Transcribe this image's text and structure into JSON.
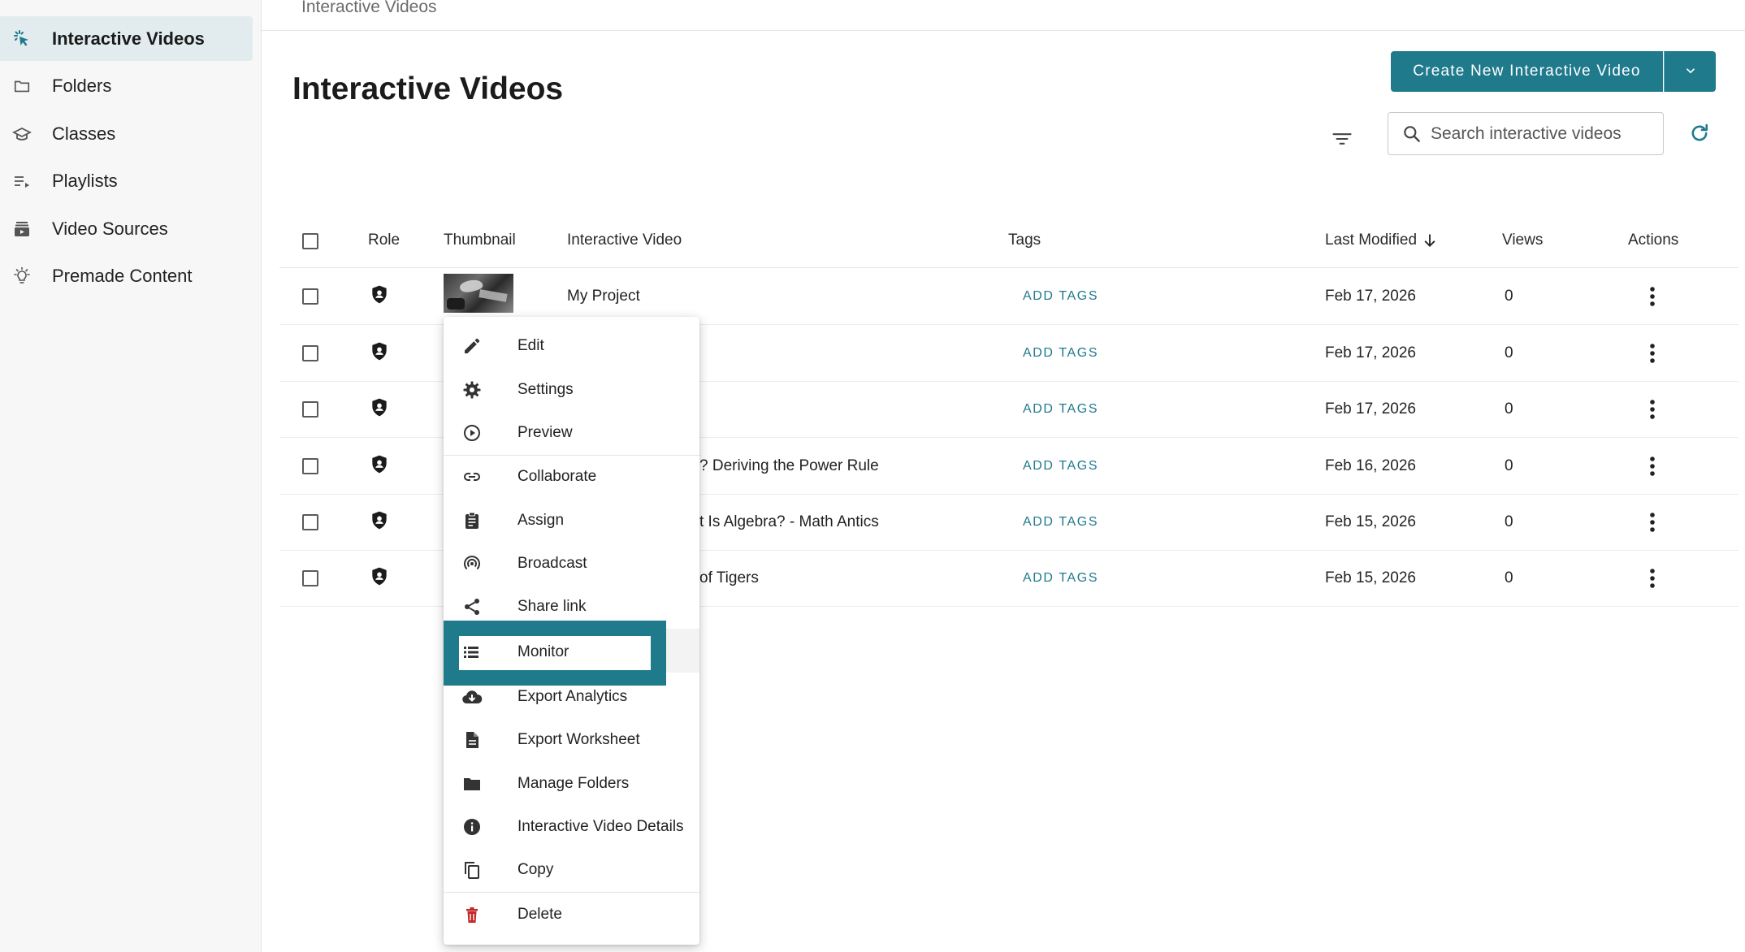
{
  "colors": {
    "accent": "#1f7a8c",
    "delete": "#c62828",
    "highlight": "#1f7a8c"
  },
  "sidebar": {
    "items": [
      {
        "label": "Interactive Videos",
        "icon": "cursor-click-icon",
        "active": true
      },
      {
        "label": "Folders",
        "icon": "folder-icon"
      },
      {
        "label": "Classes",
        "icon": "graduation-cap-icon"
      },
      {
        "label": "Playlists",
        "icon": "playlist-icon"
      },
      {
        "label": "Video Sources",
        "icon": "video-library-icon"
      },
      {
        "label": "Premade Content",
        "icon": "lightbulb-icon"
      }
    ]
  },
  "header": {
    "breadcrumb": "Interactive Videos",
    "title": "Interactive Videos",
    "create_label": "Create New Interactive Video",
    "search_placeholder": "Search interactive videos"
  },
  "table": {
    "columns": {
      "role": "Role",
      "thumbnail": "Thumbnail",
      "video": "Interactive Video",
      "tags": "Tags",
      "modified": "Last Modified",
      "views": "Views",
      "actions": "Actions"
    },
    "rows": [
      {
        "title": "My Project",
        "tags": "ADD TAGS",
        "modified": "Feb 17, 2026",
        "views": "0"
      },
      {
        "title": "",
        "tags": "ADD TAGS",
        "modified": "Feb 17, 2026",
        "views": "0"
      },
      {
        "title": "",
        "tags": "ADD TAGS",
        "modified": "Feb 17, 2026",
        "views": "0"
      },
      {
        "title": "? Deriving the Power Rule",
        "tags": "ADD TAGS",
        "modified": "Feb 16, 2026",
        "views": "0"
      },
      {
        "title": "t Is Algebra? - Math Antics",
        "tags": "ADD TAGS",
        "modified": "Feb 15, 2026",
        "views": "0"
      },
      {
        "title": "of Tigers",
        "tags": "ADD TAGS",
        "modified": "Feb 15, 2026",
        "views": "0"
      }
    ]
  },
  "menu": {
    "items": [
      {
        "label": "Edit",
        "icon": "pencil-icon"
      },
      {
        "label": "Settings",
        "icon": "gear-icon"
      },
      {
        "label": "Preview",
        "icon": "play-circle-icon"
      },
      {
        "label": "Collaborate",
        "icon": "link-icon"
      },
      {
        "label": "Assign",
        "icon": "clipboard-icon"
      },
      {
        "label": "Broadcast",
        "icon": "broadcast-icon"
      },
      {
        "label": "Share link",
        "icon": "share-icon"
      },
      {
        "label": "Monitor",
        "icon": "list-icon"
      },
      {
        "label": "Export Analytics",
        "icon": "cloud-download-icon"
      },
      {
        "label": "Export Worksheet",
        "icon": "document-icon"
      },
      {
        "label": "Manage Folders",
        "icon": "folder-filled-icon"
      },
      {
        "label": "Interactive Video Details",
        "icon": "info-icon"
      },
      {
        "label": "Copy",
        "icon": "copy-icon"
      },
      {
        "label": "Delete",
        "icon": "trash-icon"
      }
    ]
  }
}
